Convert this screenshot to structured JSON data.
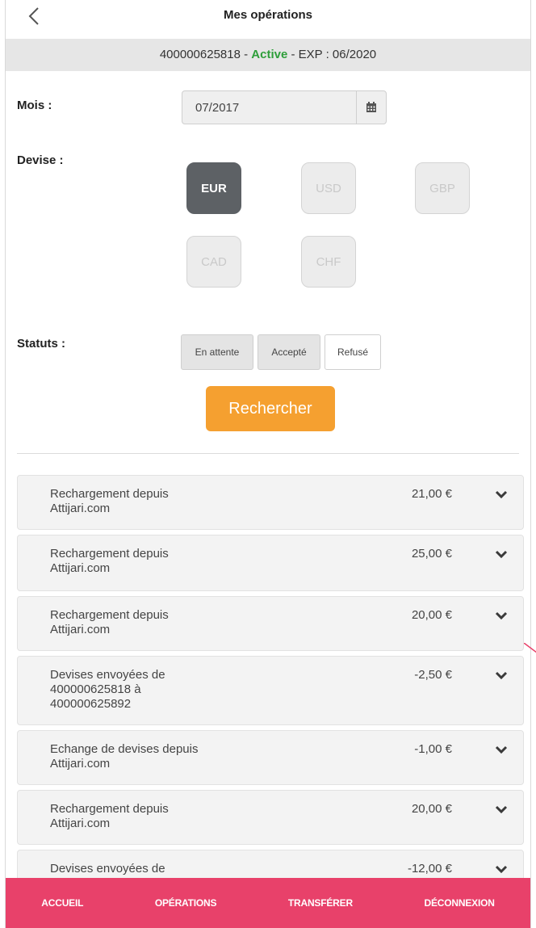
{
  "header": {
    "title": "Mes opérations"
  },
  "card": {
    "number": "400000625818",
    "status": "Active",
    "sep": " - ",
    "exp": "EXP : 06/2020"
  },
  "filters": {
    "month_label": "Mois :",
    "month_value": "07/2017",
    "currency_label": "Devise :",
    "currencies": [
      "EUR",
      "USD",
      "GBP",
      "CAD",
      "CHF"
    ],
    "selected_currency": "EUR",
    "status_label": "Statuts :",
    "statuses": [
      "En attente",
      "Accepté",
      "Refusé"
    ],
    "search_label": "Rechercher"
  },
  "operations": [
    {
      "desc": [
        "Rechargement depuis",
        "Attijari.com"
      ],
      "amount": "21,00 €"
    },
    {
      "desc": [
        "Rechargement depuis",
        "Attijari.com"
      ],
      "amount": "25,00 €"
    },
    {
      "desc": [
        "Rechargement depuis",
        "Attijari.com"
      ],
      "amount": "20,00 €"
    },
    {
      "desc": [
        "Devises envoyées de",
        "400000625818 à",
        "400000625892"
      ],
      "amount": "-2,50 €"
    },
    {
      "desc": [
        "Echange de devises depuis",
        "Attijari.com"
      ],
      "amount": "-1,00 €"
    },
    {
      "desc": [
        "Rechargement depuis",
        "Attijari.com"
      ],
      "amount": "20,00 €"
    },
    {
      "desc": [
        "Devises envoyées de"
      ],
      "amount": "-12,00 €"
    }
  ],
  "nav": [
    "ACCUEIL",
    "OPÉRATIONS",
    "TRANSFÉRER",
    "DÉCONNEXION"
  ],
  "colors": {
    "accent": "#f5a030",
    "nav": "#e8416a",
    "active_status": "#2e9e3a",
    "selected_currency": "#5d6165"
  }
}
